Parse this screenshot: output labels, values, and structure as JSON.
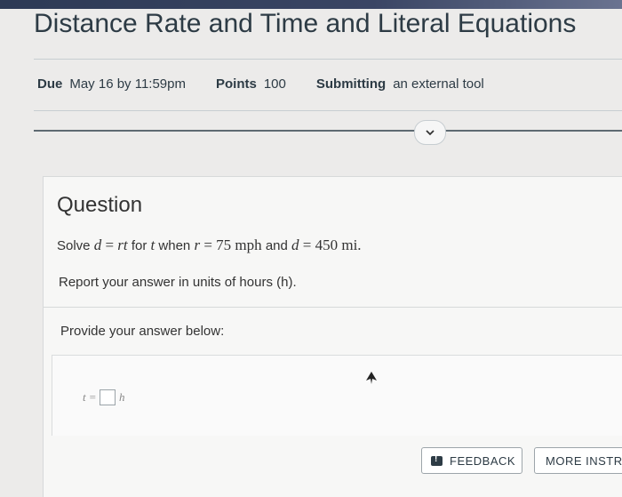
{
  "page": {
    "title": "Distance Rate and Time and Literal Equations"
  },
  "meta": {
    "due_label": "Due",
    "due_value": "May 16 by 11:59pm",
    "points_label": "Points",
    "points_value": "100",
    "submitting_label": "Submitting",
    "submitting_value": "an external tool"
  },
  "expand": {
    "icon": "chevron-down-icon"
  },
  "question": {
    "heading": "Question",
    "solve_prefix": "Solve",
    "eq_d": "d",
    "eq_equals": "=",
    "eq_rt": "rt",
    "for_text": "for",
    "var_t": "t",
    "when_text": "when",
    "var_r": "r",
    "equals2": "=",
    "r_value": "75 mph",
    "and_text": "and",
    "var_d2": "d",
    "equals3": "=",
    "d_value": "450 mi.",
    "units_instruction": "Report your answer in units of hours (h)."
  },
  "answer": {
    "prompt": "Provide your answer below:",
    "var": "t",
    "equals": "=",
    "value": "",
    "unit": "h"
  },
  "buttons": {
    "feedback_label": "FEEDBACK",
    "feedback_icon": "feedback-icon",
    "more_label": "MORE INSTRU"
  }
}
